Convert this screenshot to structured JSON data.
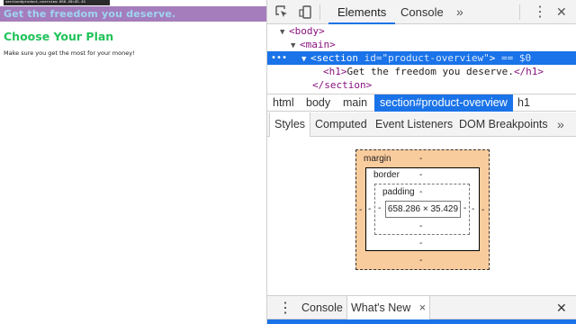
{
  "preview": {
    "tooltip": "section#product-overview  658.29×35.43",
    "hero_text": "Get the freedom you deserve.",
    "plan_title": "Choose Your Plan",
    "plan_subtitle": "Make sure you get the most for your money!"
  },
  "devtools": {
    "tabs": [
      {
        "label": "Elements",
        "active": true
      },
      {
        "label": "Console",
        "active": false
      }
    ],
    "more_label": "»",
    "menu_label": "⋮",
    "close_label": "✕",
    "dom": {
      "body_tag": "<body>",
      "main_tag": "<main>",
      "section_open": "<section",
      "section_attr_name": " id=",
      "section_attr_value": "\"product-overview\"",
      "section_close_bracket": ">",
      "selection_marker": " == $0",
      "h1_open": "<h1>",
      "h1_text": "Get the freedom you deserve.",
      "h1_close": "</h1>",
      "section_end": "</section>"
    },
    "breadcrumbs": [
      {
        "label": "html",
        "active": false
      },
      {
        "label": "body",
        "active": false
      },
      {
        "label": "main",
        "active": false
      },
      {
        "label": "section#product-overview",
        "active": true
      },
      {
        "label": "h1",
        "active": false
      }
    ],
    "subtabs": [
      {
        "label": "Styles",
        "active": true
      },
      {
        "label": "Computed",
        "active": false
      },
      {
        "label": "Event Listeners",
        "active": false
      },
      {
        "label": "DOM Breakpoints",
        "active": false
      }
    ],
    "box_model": {
      "margin_label": "margin",
      "border_label": "border",
      "padding_label": "padding",
      "dash": "-",
      "content_size": "658.286 × 35.429"
    },
    "drawer": {
      "tabs": [
        {
          "label": "Console",
          "active": false
        },
        {
          "label": "What's New",
          "active": true
        }
      ],
      "tab_close": "×"
    }
  },
  "colors": {
    "accent": "#1a73e8",
    "margin_fill": "#f9cc9d",
    "hero_band": "#a57dbd",
    "plan_title": "#22c35a"
  }
}
